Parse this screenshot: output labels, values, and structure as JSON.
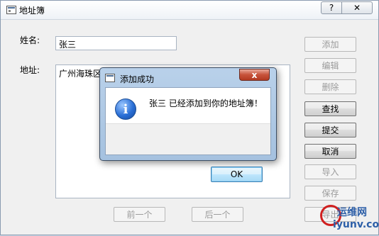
{
  "window": {
    "title": "地址簿",
    "help_label": "?",
    "close_label": "✕"
  },
  "form": {
    "name_label": "姓名:",
    "name_value": "张三",
    "address_label": "地址:",
    "address_value": "广州海珠区"
  },
  "buttons": {
    "add": "添加",
    "edit": "编辑",
    "delete": "删除",
    "find": "查找",
    "submit": "提交",
    "cancel": "取消",
    "import": "导入",
    "save": "保存",
    "export": "导出",
    "prev": "前一个",
    "next": "后一个"
  },
  "dialog": {
    "title": "添加成功",
    "close_label": "x",
    "message": "张三 已经添加到你的地址簿！",
    "icon_glyph": "i",
    "ok_label": "OK"
  },
  "watermark": {
    "line1": "运维网",
    "line2": "iyunv.com"
  },
  "colors": {
    "dialog_frame": "#b9d1ea",
    "close_red": "#c7523a",
    "ok_border": "#3c7fb1"
  }
}
